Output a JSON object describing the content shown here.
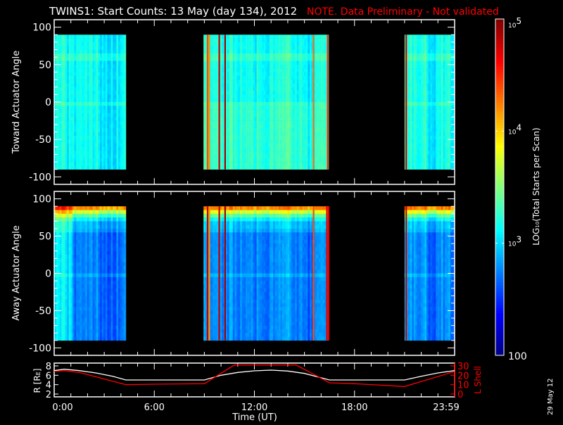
{
  "title": "TWINS1: Start Counts: 13 May (day 134), 2012",
  "note": "NOTE. Data Preliminary - Not validated",
  "date_stamp": "29 May 12",
  "colors": {
    "background": "#000000",
    "axes": "#ffffff",
    "note": "#ff0000",
    "lshell": "#ff0000",
    "radius": "#ffffff"
  },
  "chart_data": [
    {
      "type": "heatmap",
      "name": "toward",
      "ylabel": "Toward Actuator Angle",
      "ylim": [
        -110,
        110
      ],
      "yticks": [
        "100",
        "50",
        "0",
        "-50",
        "-100"
      ],
      "ytick_values": [
        100,
        50,
        0,
        -50,
        -100
      ],
      "data_angle_range": [
        -90,
        90
      ],
      "xlim_hours": [
        0,
        24
      ],
      "data_segments_hours": [
        [
          0,
          4.3
        ],
        [
          8.95,
          16.45
        ],
        [
          21.0,
          24
        ]
      ],
      "typical_log10_counts": 3.15,
      "spikes": [
        {
          "t": 9.15,
          "log10": 4.4
        },
        {
          "t": 9.25,
          "log10": 4.2
        },
        {
          "t": 9.85,
          "log10": 4.8
        },
        {
          "t": 10.2,
          "log10": 4.9
        },
        {
          "t": 15.5,
          "log10": 4.3
        },
        {
          "t": 16.35,
          "log10": 4.5
        },
        {
          "t": 21.05,
          "log10": 4.8
        }
      ]
    },
    {
      "type": "heatmap",
      "name": "away",
      "ylabel": "Away Actuator Angle",
      "ylim": [
        -110,
        110
      ],
      "yticks": [
        "100",
        "50",
        "0",
        "-50",
        "-100"
      ],
      "ytick_values": [
        100,
        50,
        0,
        -50,
        -100
      ],
      "data_angle_range": [
        -90,
        90
      ],
      "xlim_hours": [
        0,
        24
      ],
      "data_segments_hours": [
        [
          0,
          4.3
        ],
        [
          8.95,
          16.45
        ],
        [
          21.0,
          24
        ]
      ],
      "typical_log10_counts": 2.75,
      "edge_enhancement_log10_at_90deg": 4.2,
      "spikes": [
        {
          "t": 9.15,
          "log10": 4.8
        },
        {
          "t": 9.25,
          "log10": 4.2
        },
        {
          "t": 9.85,
          "log10": 4.8
        },
        {
          "t": 10.2,
          "log10": 4.9
        },
        {
          "t": 15.5,
          "log10": 4.4
        },
        {
          "t": 16.3,
          "log10": 4.7
        },
        {
          "t": 16.4,
          "log10": 4.7
        },
        {
          "t": 21.05,
          "log10": 4.8
        }
      ]
    },
    {
      "type": "line",
      "name": "orbit",
      "xlabel": "Time (UT)",
      "xticks": [
        "0:00",
        "6:00",
        "12:00",
        "18:00",
        "23:59"
      ],
      "xtick_hours": [
        0,
        6,
        12,
        18,
        24
      ],
      "ylabel": "R [R",
      "ylabel_sub": "E",
      "ylabel_end": "]",
      "ylim": [
        2,
        8
      ],
      "yticks": [
        "8",
        "6",
        "4",
        "2"
      ],
      "ytick_values": [
        8,
        6,
        4,
        2
      ],
      "y2label": "L Shell",
      "y2lim": [
        0,
        30
      ],
      "y2ticks": [
        "30",
        "20",
        "10",
        "0"
      ],
      "y2tick_values": [
        30,
        20,
        10,
        0
      ],
      "series": [
        {
          "name": "R",
          "x": [
            0,
            0.6,
            1.5,
            2.5,
            3.5,
            4.3,
            9.0,
            10,
            11,
            12,
            13,
            14,
            15,
            16.5,
            21.0,
            22,
            23,
            24
          ],
          "y": [
            7.0,
            7.3,
            7.0,
            6.5,
            5.8,
            5.0,
            5.0,
            6.0,
            6.6,
            6.95,
            7.1,
            6.9,
            6.4,
            5.0,
            5.0,
            5.8,
            6.5,
            7.0
          ]
        },
        {
          "name": "L Shell",
          "x": [
            0,
            0.6,
            1.5,
            4.3,
            6,
            9.0,
            10.8,
            14.5,
            16.5,
            18,
            21.0,
            24
          ],
          "y": [
            24,
            25,
            23,
            10,
            10.5,
            11,
            31,
            31,
            12,
            11,
            8,
            24
          ]
        }
      ]
    },
    {
      "type": "colorbar",
      "label_prefix": "LOG",
      "label_sub": "10",
      "label_suffix": "(Total Starts per Scan)",
      "range_log10": [
        2,
        5
      ],
      "ticks": [
        {
          "base": "10",
          "exp": "5",
          "log10": 5
        },
        {
          "base": "10",
          "exp": "4",
          "log10": 4
        },
        {
          "base": "10",
          "exp": "3",
          "log10": 3
        },
        {
          "base": "100",
          "exp": "",
          "log10": 2
        }
      ]
    }
  ]
}
